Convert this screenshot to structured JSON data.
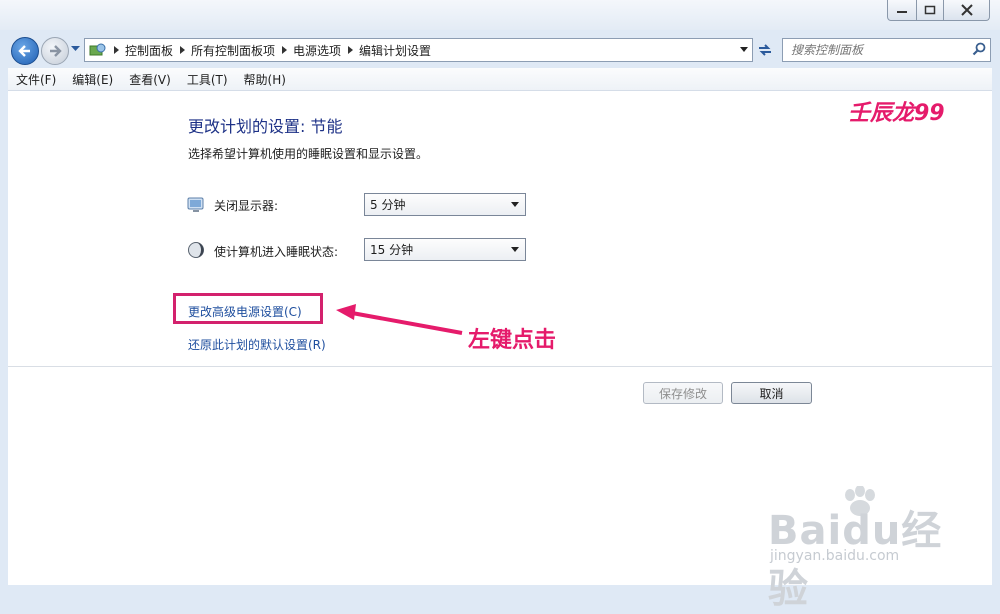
{
  "address": {
    "crumbs": [
      "控制面板",
      "所有控制面板项",
      "电源选项",
      "编辑计划设置"
    ]
  },
  "search": {
    "placeholder": "搜索控制面板"
  },
  "menu": [
    "文件(F)",
    "编辑(E)",
    "查看(V)",
    "工具(T)",
    "帮助(H)"
  ],
  "main": {
    "title": "更改计划的设置: 节能",
    "subtitle": "选择希望计算机使用的睡眠设置和显示设置。",
    "display_off": {
      "label": "关闭显示器:",
      "value": "5 分钟"
    },
    "sleep": {
      "label": "使计算机进入睡眠状态:",
      "value": "15 分钟"
    },
    "advanced_link": "更改高级电源设置(C)",
    "restore_link": "还原此计划的默认设置(R)",
    "save_button": "保存修改",
    "cancel_button": "取消"
  },
  "annotations": {
    "watermark": "壬辰龙99",
    "instruction": "左键点击",
    "arrow_color": "#e51b6b"
  },
  "baidu": {
    "logo": "Baidu经验",
    "url": "jingyan.baidu.com"
  }
}
